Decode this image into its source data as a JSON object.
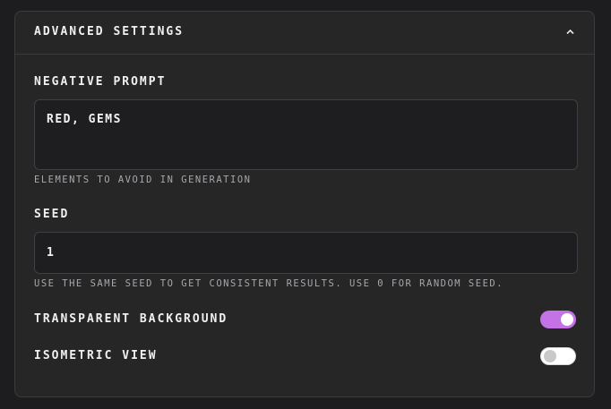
{
  "panel": {
    "title": "ADVANCED SETTINGS",
    "collapse_icon": "chevron-up-icon"
  },
  "negative_prompt": {
    "label": "NEGATIVE PROMPT",
    "value": "RED, GEMS",
    "hint": "ELEMENTS TO AVOID IN GENERATION"
  },
  "seed": {
    "label": "SEED",
    "value": "1",
    "hint": "USE THE SAME SEED TO GET CONSISTENT RESULTS. USE 0 FOR RANDOM SEED."
  },
  "toggles": [
    {
      "label": "TRANSPARENT BACKGROUND",
      "on": true
    },
    {
      "label": "ISOMETRIC VIEW",
      "on": false
    }
  ],
  "colors": {
    "accent": "#c472e6",
    "panel_bg": "#262627",
    "input_bg": "#1e1e20"
  }
}
